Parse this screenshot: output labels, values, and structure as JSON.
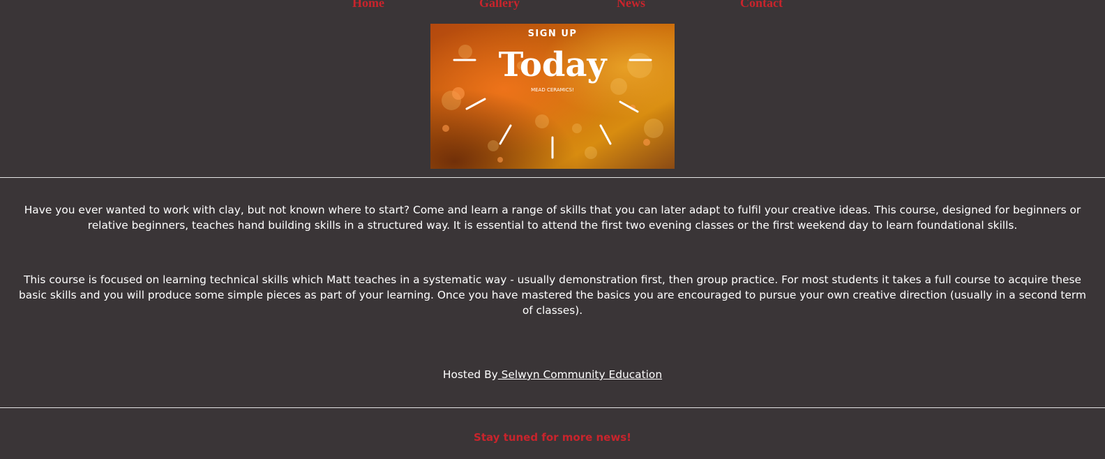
{
  "nav": {
    "items": [
      {
        "label": "Home"
      },
      {
        "label": "Gallery"
      },
      {
        "label": "News"
      },
      {
        "label": "Contact"
      }
    ],
    "color": "#c8242c"
  },
  "banner": {
    "top_text": "SIGN UP",
    "headline": "Today",
    "subtext": "MEAD CERAMICS!"
  },
  "content": {
    "paragraph1": "Have you ever wanted to work with clay, but not known where to start? Come and learn a range of skills that you can later adapt to fulfil your creative ideas. This course, designed for beginners or relative beginners, teaches hand building skills in a structured way. It is essential to attend the first two evening classes or the first weekend day to learn foundational skills.",
    "paragraph2": "This course is focused on learning technical skills which Matt teaches in a systematic way - usually demonstration first, then group practice. For most students it takes a full course to acquire these basic skills and you will produce some simple pieces as part of your learning. Once you have mastered the basics you are encouraged to pursue your own creative direction (usually in a second term of classes).",
    "hosted_prefix": "Hosted By",
    "hosted_link": " Selwyn Community Education"
  },
  "footer": {
    "note": "Stay tuned for more news!"
  },
  "colors": {
    "background": "#3a3537",
    "accent": "#c8242c",
    "text": "#ffffff"
  }
}
